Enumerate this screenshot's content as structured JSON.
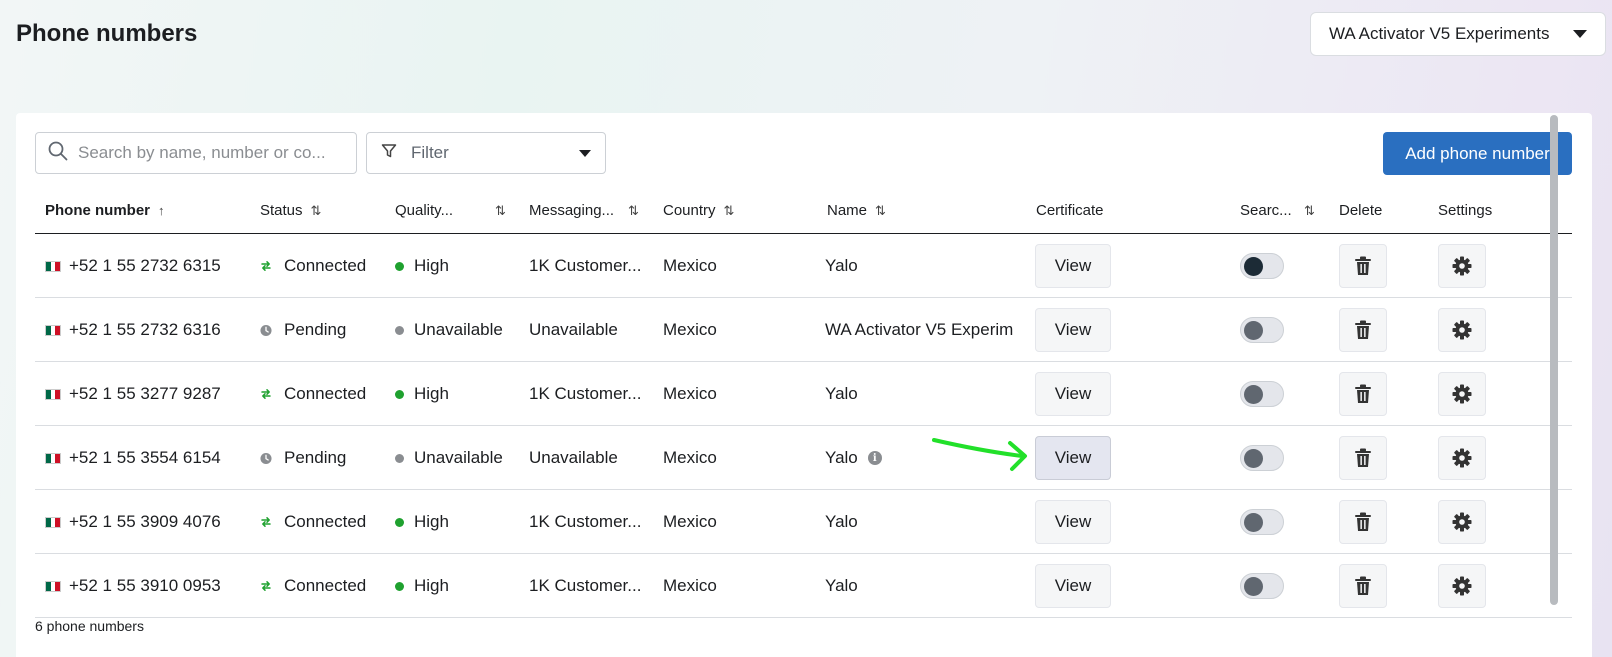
{
  "header": {
    "title": "Phone numbers",
    "account_selector": "WA Activator V5 Experiments"
  },
  "toolbar": {
    "search_placeholder": "Search by name, number or co...",
    "filter_label": "Filter",
    "add_button": "Add phone number"
  },
  "table": {
    "columns": [
      "Phone number",
      "Status",
      "Quality...",
      "Messaging...",
      "Country",
      "Name",
      "Certificate",
      "Searc...",
      "Delete",
      "Settings"
    ],
    "rows": [
      {
        "phone": "+52 1 55 2732 6315",
        "status": "Connected",
        "status_type": "connected",
        "quality": "High",
        "quality_color": "#1fa12f",
        "messaging": "1K Customer...",
        "country": "Mexico",
        "name": "Yalo",
        "certificate": "View",
        "searchable_on": true,
        "info": false
      },
      {
        "phone": "+52 1 55 2732 6316",
        "status": "Pending",
        "status_type": "pending",
        "quality": "Unavailable",
        "quality_color": "#8a8d91",
        "messaging": "Unavailable",
        "country": "Mexico",
        "name": "WA Activator V5 Experim",
        "certificate": "View",
        "searchable_on": false,
        "info": false
      },
      {
        "phone": "+52 1 55 3277 9287",
        "status": "Connected",
        "status_type": "connected",
        "quality": "High",
        "quality_color": "#1fa12f",
        "messaging": "1K Customer...",
        "country": "Mexico",
        "name": "Yalo",
        "certificate": "View",
        "searchable_on": false,
        "info": false
      },
      {
        "phone": "+52 1 55 3554 6154",
        "status": "Pending",
        "status_type": "pending",
        "quality": "Unavailable",
        "quality_color": "#8a8d91",
        "messaging": "Unavailable",
        "country": "Mexico",
        "name": "Yalo",
        "certificate": "View",
        "searchable_on": false,
        "info": true
      },
      {
        "phone": "+52 1 55 3909 4076",
        "status": "Connected",
        "status_type": "connected",
        "quality": "High",
        "quality_color": "#1fa12f",
        "messaging": "1K Customer...",
        "country": "Mexico",
        "name": "Yalo",
        "certificate": "View",
        "searchable_on": false,
        "info": false
      },
      {
        "phone": "+52 1 55 3910 0953",
        "status": "Connected",
        "status_type": "connected",
        "quality": "High",
        "quality_color": "#1fa12f",
        "messaging": "1K Customer...",
        "country": "Mexico",
        "name": "Yalo",
        "certificate": "View",
        "searchable_on": false,
        "info": false
      }
    ]
  },
  "footer": {
    "count_text": "6 phone numbers"
  },
  "colors": {
    "accent": "#2a6fc0",
    "connected": "#1fa12f",
    "annotation_arrow": "#22e02a"
  }
}
